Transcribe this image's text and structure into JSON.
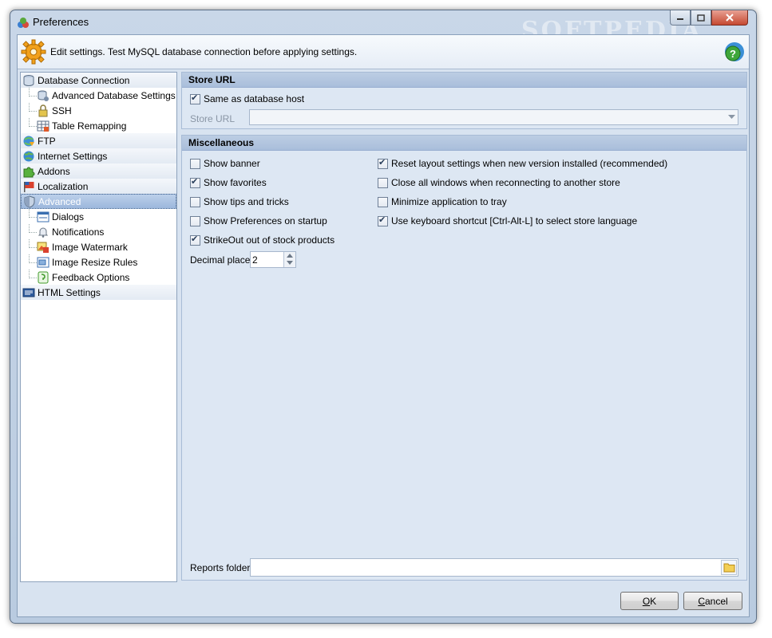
{
  "window": {
    "title": "Preferences",
    "watermark": "SOFTPEDIA"
  },
  "header": {
    "text": "Edit settings. Test MySQL database connection before applying settings."
  },
  "tree": {
    "items": [
      {
        "label": "Database Connection",
        "level": 0,
        "icon": "database-icon"
      },
      {
        "label": "Advanced Database Settings",
        "level": 1,
        "icon": "database-settings-icon"
      },
      {
        "label": "SSH",
        "level": 1,
        "icon": "lock-icon"
      },
      {
        "label": "Table Remapping",
        "level": 1,
        "icon": "table-icon"
      },
      {
        "label": "FTP",
        "level": 0,
        "icon": "ftp-icon"
      },
      {
        "label": "Internet Settings",
        "level": 0,
        "icon": "globe-icon"
      },
      {
        "label": "Addons",
        "level": 0,
        "icon": "puzzle-icon"
      },
      {
        "label": "Localization",
        "level": 0,
        "icon": "flag-icon"
      },
      {
        "label": "Advanced",
        "level": 0,
        "icon": "shield-icon",
        "selected": true
      },
      {
        "label": "Dialogs",
        "level": 1,
        "icon": "dialog-icon"
      },
      {
        "label": "Notifications",
        "level": 1,
        "icon": "bell-icon"
      },
      {
        "label": "Image Watermark",
        "level": 1,
        "icon": "image-icon"
      },
      {
        "label": "Image Resize Rules",
        "level": 1,
        "icon": "resize-icon"
      },
      {
        "label": "Feedback Options",
        "level": 1,
        "icon": "feedback-icon"
      },
      {
        "label": "HTML Settings",
        "level": 0,
        "icon": "html-icon"
      }
    ]
  },
  "store_url": {
    "header": "Store URL",
    "same_as_host": {
      "label": "Same as database host",
      "checked": true
    },
    "url_label": "Store URL",
    "url_value": ""
  },
  "misc": {
    "header": "Miscellaneous",
    "left_checks": [
      {
        "label": "Show banner",
        "checked": false
      },
      {
        "label": "Show favorites",
        "checked": true
      },
      {
        "label": "Show tips and tricks",
        "checked": false
      },
      {
        "label": "Show Preferences on startup",
        "checked": false
      },
      {
        "label": "StrikeOut out of stock products",
        "checked": true
      }
    ],
    "right_checks": [
      {
        "label": "Reset layout settings when new version installed (recommended)",
        "checked": true
      },
      {
        "label": "Close all windows when reconnecting to another store",
        "checked": false
      },
      {
        "label": "Minimize application to tray",
        "checked": false
      },
      {
        "label": "Use keyboard shortcut [Ctrl-Alt-L] to select store language",
        "checked": true
      }
    ],
    "decimal_label": "Decimal places",
    "decimal_value": "2",
    "reports_label": "Reports folder",
    "reports_value": ""
  },
  "buttons": {
    "ok_prefix": "",
    "ok_key": "O",
    "ok_rest": "K",
    "cancel_key": "C",
    "cancel_rest": "ancel"
  }
}
